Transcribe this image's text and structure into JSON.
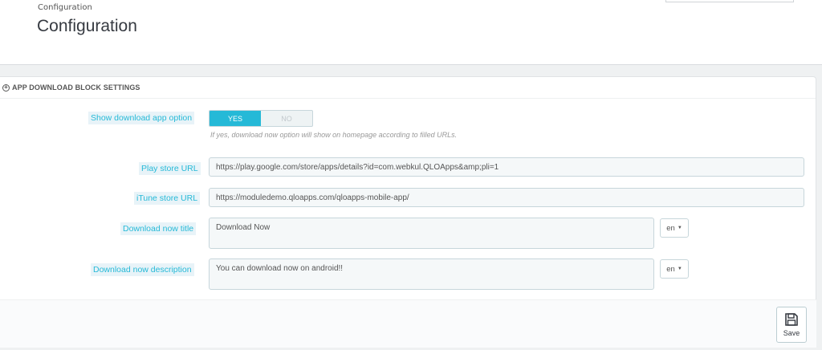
{
  "header": {
    "breadcrumb": "Configuration",
    "title": "Configuration"
  },
  "panel": {
    "heading_icon": "plus-circle-icon",
    "heading": "APP DOWNLOAD BLOCK SETTINGS"
  },
  "form": {
    "show_download": {
      "label": "Show download app option",
      "yes": "YES",
      "no": "NO",
      "selected": "YES",
      "help": "If yes, download now option will show on homepage according to filled URLs."
    },
    "play_store": {
      "label": "Play store URL",
      "value": "https://play.google.com/store/apps/details?id=com.webkul.QLOApps&amp;pli=1"
    },
    "itune_store": {
      "label": "iTune store URL",
      "value": "https://moduledemo.qloapps.com/qloapps-mobile-app/"
    },
    "download_title": {
      "label": "Download now title",
      "value": "Download Now",
      "lang": "en"
    },
    "download_description": {
      "label": "Download now description",
      "value": "You can download now on android!!",
      "lang": "en"
    }
  },
  "footer": {
    "save_label": "Save",
    "save_icon": "floppy-disk-icon"
  },
  "colors": {
    "accent": "#25b9d7",
    "label_bg": "#e8f3f8",
    "input_bg": "#f5f8f9"
  }
}
